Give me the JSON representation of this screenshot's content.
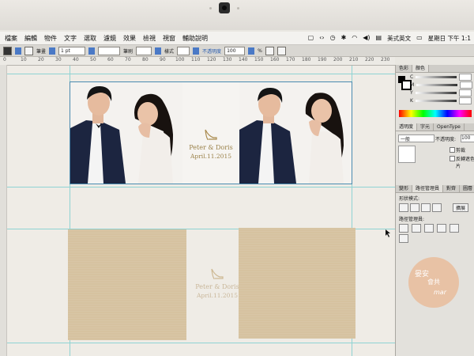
{
  "menubar": {
    "items": [
      "檔案",
      "編輯",
      "物件",
      "文字",
      "選取",
      "濾鏡",
      "效果",
      "檢視",
      "視窗",
      "輔助說明"
    ],
    "input_source": "美式英文",
    "clock": "星期日 下午 1:1"
  },
  "controlbar": {
    "stroke_label": "筆畫",
    "stroke_weight": "1 pt",
    "brush_label": "筆刷",
    "style_label": "樣式",
    "opacity_label": "不透明度",
    "opacity_value": "100",
    "opacity_unit": "%"
  },
  "ruler": {
    "ticks": [
      "0",
      "10",
      "20",
      "30",
      "40",
      "50",
      "60",
      "70",
      "80",
      "90",
      "100",
      "110",
      "120",
      "130",
      "140",
      "150",
      "160",
      "170",
      "180",
      "190",
      "200",
      "210",
      "220",
      "230"
    ]
  },
  "artwork": {
    "names": "Peter & Doris",
    "date": "April.11.2015",
    "names_faded": "Peter & Doris",
    "date_faded": "April.11.2015"
  },
  "color_panel": {
    "tabs": [
      "色彩",
      "顏色"
    ],
    "channels": [
      "C",
      "M",
      "Y",
      "K"
    ]
  },
  "transparency_panel": {
    "tabs": [
      "透明度",
      "字元",
      "OpenType"
    ],
    "blend_mode": "一般",
    "opacity_label": "不透明度:",
    "opacity_value": "100",
    "option1": "剪裁",
    "option2": "反轉遮色片"
  },
  "pathfinder_panel": {
    "tabs": [
      "變形",
      "路徑管理員",
      "對齊",
      "圖層"
    ],
    "shape_modes_label": "形狀模式:",
    "expand_label": "擴展",
    "pathfinders_label": "路徑管理員:"
  },
  "watermark": {
    "line1": "晏安",
    "line2": "會共",
    "line3": "mar"
  }
}
